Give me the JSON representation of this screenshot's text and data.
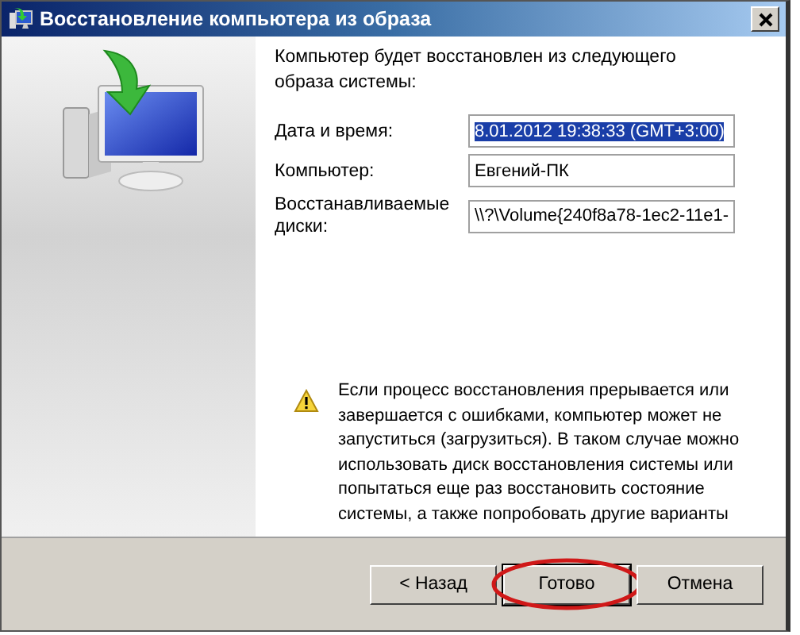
{
  "window": {
    "title": "Восстановление компьютера из образа"
  },
  "intro": "Компьютер будет восстановлен из следующего образа системы:",
  "fields": [
    {
      "label": "Дата и время:",
      "value": "8.01.2012 19:38:33 (GMT+3:00)",
      "selected": true
    },
    {
      "label": "Компьютер:",
      "value": "Евгений-ПК",
      "selected": false
    },
    {
      "label": "Восстанавливаемые диски:",
      "value": "\\\\?\\Volume{240f8a78-1ec2-11e1-",
      "selected": false
    }
  ],
  "warning": "Если процесс восстановления прерывается или завершается с ошибками, компьютер может не запуститься (загрузиться). В таком случае можно использовать диск восстановления системы или попытаться еще раз восстановить состояние системы, а также попробовать другие варианты",
  "buttons": [
    {
      "label": "< Назад",
      "default": false,
      "circled": false
    },
    {
      "label": "Готово",
      "default": true,
      "circled": true
    },
    {
      "label": "Отмена",
      "default": false,
      "circled": false
    }
  ]
}
